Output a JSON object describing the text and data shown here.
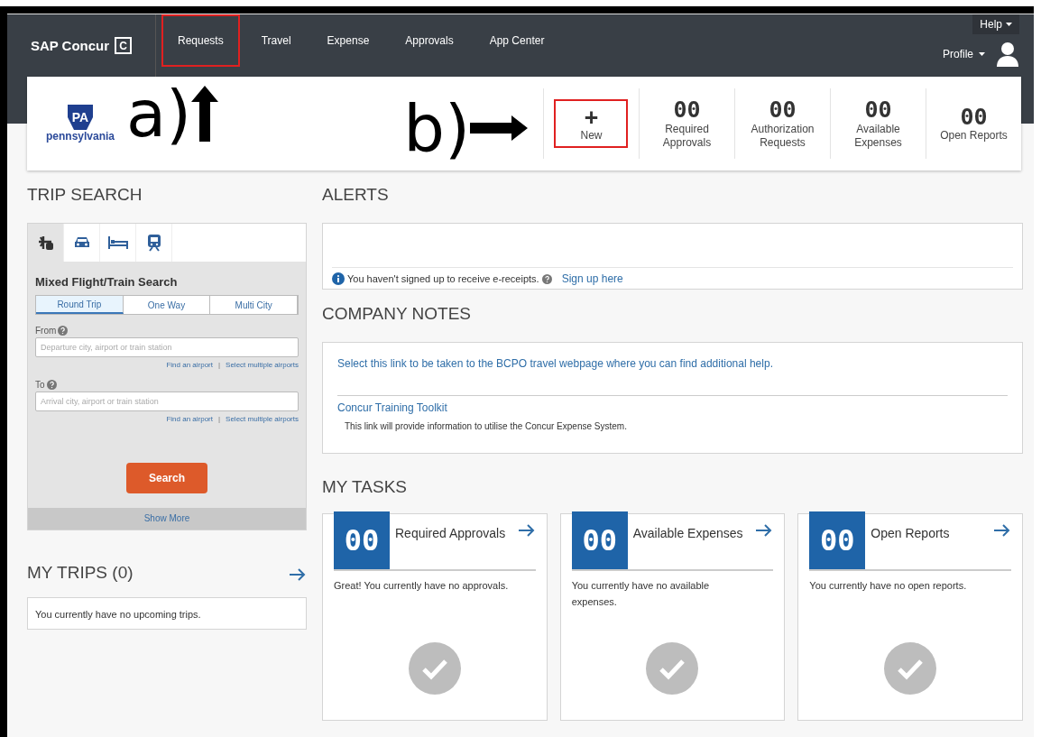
{
  "header": {
    "brand": "SAP Concur",
    "brand_mark": "C",
    "nav": [
      {
        "label": "Requests",
        "highlighted": true
      },
      {
        "label": "Travel",
        "highlighted": false
      },
      {
        "label": "Expense",
        "highlighted": false
      },
      {
        "label": "Approvals",
        "highlighted": false
      },
      {
        "label": "App Center",
        "highlighted": false
      }
    ],
    "help": "Help",
    "profile": "Profile"
  },
  "banner": {
    "logo_badge": "PA",
    "logo_text": "pennsylvania",
    "annotations": [
      {
        "label": "a)",
        "kind": "up"
      },
      {
        "label": "b)",
        "kind": "right"
      }
    ],
    "new_item": {
      "icon": "+",
      "label": "New",
      "highlighted": true
    },
    "counters": [
      {
        "value": "00",
        "label": "Required Approvals"
      },
      {
        "value": "00",
        "label": "Authorization Requests"
      },
      {
        "value": "00",
        "label": "Available Expenses"
      },
      {
        "value": "00",
        "label": "Open Reports"
      }
    ]
  },
  "trip_search": {
    "title": "TRIP SEARCH",
    "tabs": [
      {
        "kind": "flight",
        "selected": true
      },
      {
        "kind": "car",
        "selected": false
      },
      {
        "kind": "hotel",
        "selected": false
      },
      {
        "kind": "train",
        "selected": false
      }
    ],
    "form_title": "Mixed Flight/Train Search",
    "trip_types": [
      {
        "label": "Round Trip",
        "selected": true
      },
      {
        "label": "One Way",
        "selected": false
      },
      {
        "label": "Multi City",
        "selected": false
      }
    ],
    "fields": [
      {
        "label": "From",
        "placeholder": "Departure city, airport or train station",
        "links": [
          "Find an airport",
          "|",
          "Select multiple airports"
        ]
      },
      {
        "label": "To",
        "placeholder": "Arrival city, airport or train station",
        "links": [
          "Find an airport",
          "|",
          "Select multiple airports"
        ]
      }
    ],
    "search_button": "Search",
    "show_more": "Show More"
  },
  "my_trips": {
    "title": "MY TRIPS (0)",
    "message": "You currently have no upcoming trips."
  },
  "alerts": {
    "title": "ALERTS",
    "message": "You haven't signed up to receive e-receipts.",
    "link": "Sign up here"
  },
  "company_notes": {
    "title": "COMPANY NOTES",
    "link": "Select this link to be taken to the BCPO travel webpage where you can find additional help.",
    "toolkit_link": "Concur Training Toolkit",
    "toolkit_description": "This link will provide information to utilise the Concur Expense System."
  },
  "my_tasks": {
    "title": "MY TASKS",
    "cards": [
      {
        "count": "00",
        "title": "Required Approvals",
        "message": "Great! You currently have no approvals."
      },
      {
        "count": "00",
        "title": "Available Expenses",
        "message": "You currently have no available expenses."
      },
      {
        "count": "00",
        "title": "Open Reports",
        "message": "You currently have no open reports."
      }
    ]
  }
}
